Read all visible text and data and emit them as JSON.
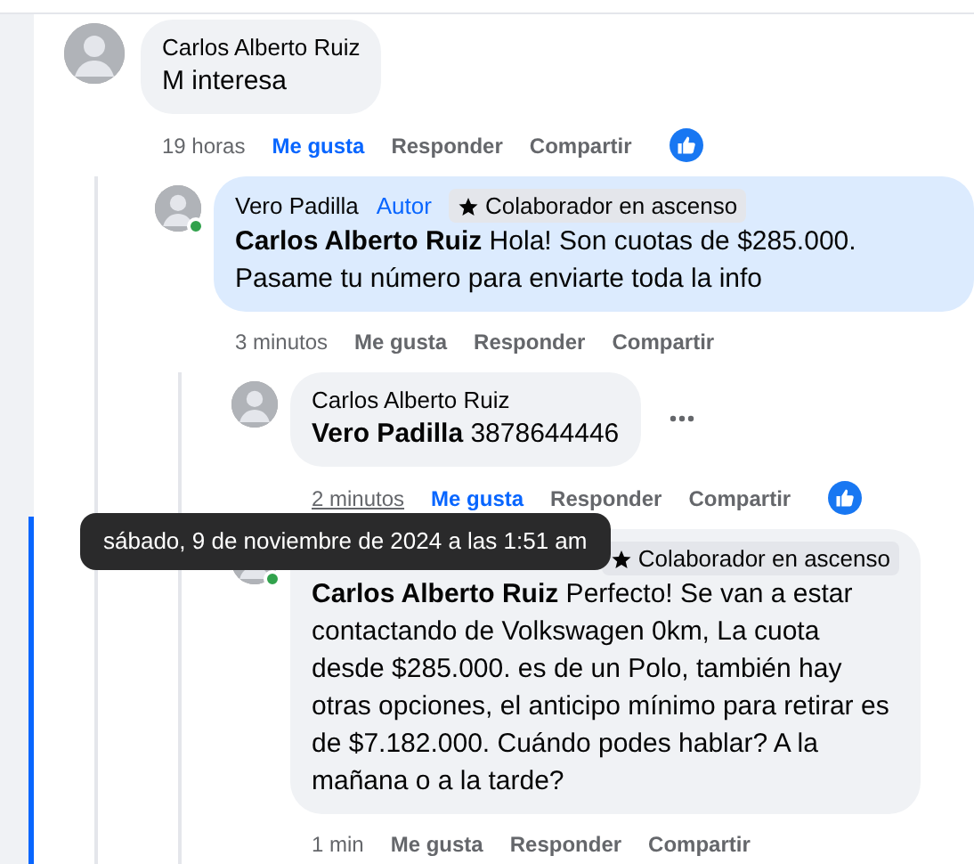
{
  "comments": [
    {
      "author": "Carlos Alberto Ruiz",
      "text": "M interesa",
      "time": "19 horas",
      "liked": true,
      "reaction_icon": true,
      "actions": [
        "Me gusta",
        "Responder",
        "Compartir"
      ],
      "children": [
        {
          "author": "Vero Padilla",
          "online": true,
          "author_badge": "Autor",
          "badge": "Colaborador en ascenso",
          "highlighted": true,
          "text": "**Carlos Alberto Ruiz** Hola! Son cuotas de $285.000. Pasame tu número para enviarte toda la info",
          "time": "3 minutos",
          "liked": false,
          "actions": [
            "Me gusta",
            "Responder",
            "Compartir"
          ],
          "children": [
            {
              "author": "Carlos Alberto Ruiz",
              "text": "**Vero Padilla** 3878644446",
              "time": "2 minutos",
              "time_hovered": true,
              "liked": true,
              "reaction_icon": true,
              "show_menu": true,
              "actions": [
                "Me gusta",
                "Responder",
                "Compartir"
              ],
              "tooltip": "sábado, 9 de noviembre de 2024 a las 1:51 am"
            },
            {
              "online": true,
              "badge": "Colaborador en ascenso",
              "text": "**Carlos Alberto Ruiz** Perfecto! Se van a estar contactando de Volkswagen 0km, La cuota desde $285.000. es de un Polo, también hay otras opciones, el anticipo mínimo para retirar es de $7.182.000. Cuándo podes hablar? A la mañana o a la tarde?",
              "time": "1 min",
              "liked": false,
              "actions": [
                "Me gusta",
                "Responder",
                "Compartir"
              ]
            }
          ]
        }
      ]
    }
  ]
}
